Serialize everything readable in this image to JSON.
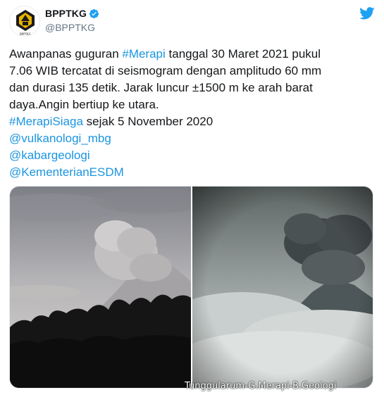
{
  "account": {
    "display_name": "BPPTKG",
    "handle": "@BPPTKG",
    "avatar_label": "BPPTKG",
    "verified": true
  },
  "tweet": {
    "lines": [
      [
        {
          "t": "Awanpanas guguran ",
          "link": false
        },
        {
          "t": "#Merapi",
          "link": true
        },
        {
          "t": " tanggal 30 Maret 2021 pukul",
          "link": false
        }
      ],
      [
        {
          "t": "7.06 WIB tercatat di seismogram dengan amplitudo 60 mm",
          "link": false
        }
      ],
      [
        {
          "t": "dan durasi 135 detik. Jarak luncur ±1500 m ke arah barat",
          "link": false
        }
      ],
      [
        {
          "t": "daya.Angin bertiup ke utara.",
          "link": false
        }
      ],
      [
        {
          "t": "#MerapiSiaga",
          "link": true
        },
        {
          "t": " sejak 5 November 2020",
          "link": false
        }
      ],
      [
        {
          "t": "@vulkanologi_mbg",
          "link": true
        }
      ],
      [
        {
          "t": "@kabargeologi",
          "link": true
        }
      ],
      [
        {
          "t": "@KementerianESDM",
          "link": true
        }
      ]
    ]
  },
  "media": {
    "right_caption": "Tunggularum-G.Merapi-B.Geologi"
  },
  "colors": {
    "link": "#1b95e0",
    "twitter_blue": "#1da1f2",
    "text": "#14171a",
    "secondary": "#657786"
  },
  "icons": {
    "verified": "verified-badge-icon",
    "brand": "twitter-bird-icon"
  }
}
